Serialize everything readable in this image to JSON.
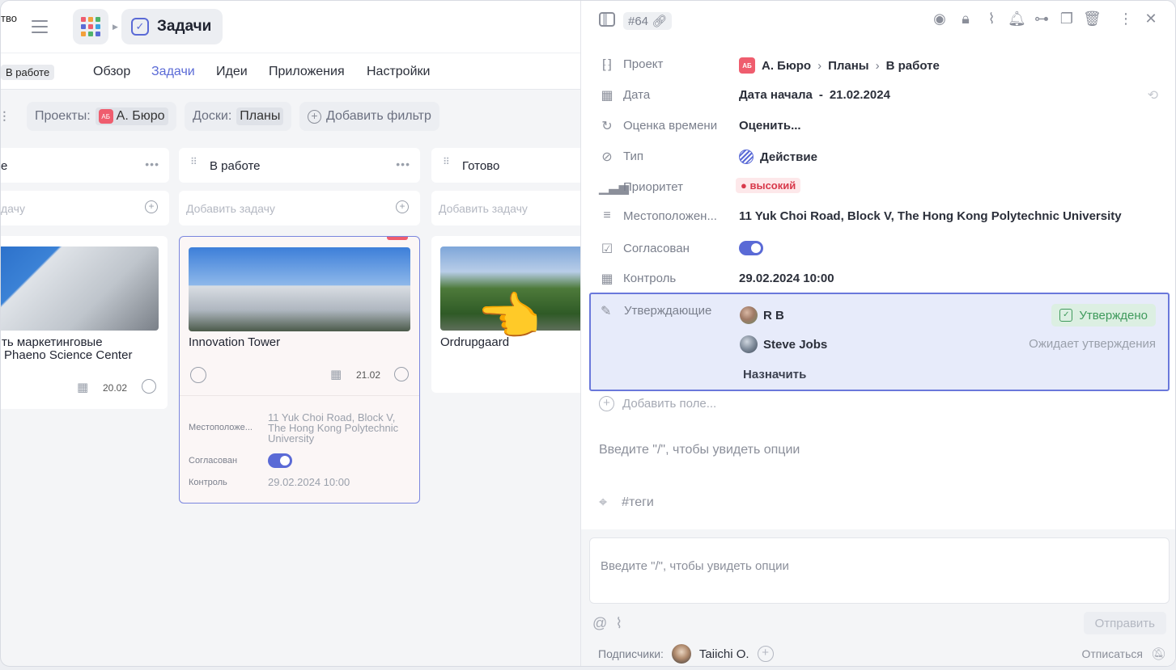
{
  "workspace": {
    "name_cut": "тво",
    "status_tag": "В работе"
  },
  "header": {
    "title": "Задачи"
  },
  "nav": {
    "items": [
      "Обзор",
      "Задачи",
      "Идеи",
      "Приложения",
      "Настройки"
    ],
    "active": "Задачи"
  },
  "filters": {
    "projects_label": "Проекты:",
    "projects_value": "А. Бюро",
    "projects_badge": "АБ",
    "boards_label": "Доски:",
    "boards_value": "Планы",
    "add_filter": "Добавить фильтр"
  },
  "columns": [
    {
      "name": "е",
      "add_placeholder": "дачу"
    },
    {
      "name": "В работе",
      "add_placeholder": "Добавить задачу"
    },
    {
      "name": "Готово",
      "add_placeholder": "Добавить задачу"
    }
  ],
  "cards": {
    "c1": {
      "title_line1": "ть маркетинговые",
      "title_line2": "Phaeno Science Center",
      "date": "20.02"
    },
    "c2": {
      "title": "Innovation Tower",
      "date": "21.02",
      "location_label": "Местоположе...",
      "location_value": "11 Yuk Choi Road, Block V, The Hong Kong Polytechnic University",
      "agreed_label": "Согласован",
      "control_label": "Контроль",
      "control_value": "29.02.2024 10:00"
    },
    "c3": {
      "title": "Ordrupgaard"
    }
  },
  "panel": {
    "task_id": "#64",
    "fields": {
      "project": {
        "label": "Проект",
        "badge": "АБ",
        "path": [
          "А. Бюро",
          "Планы",
          "В работе"
        ]
      },
      "date": {
        "label": "Дата",
        "value_start": "Дата начала",
        "separator": "-",
        "value_date": "21.02.2024"
      },
      "estimate": {
        "label": "Оценка времени",
        "value": "Оценить..."
      },
      "type": {
        "label": "Тип",
        "value": "Действие"
      },
      "priority": {
        "label": "Приоритет",
        "value": "высокий"
      },
      "location": {
        "label": "Местоположен...",
        "value": "11 Yuk Choi Road, Block V, The Hong Kong Polytechnic University"
      },
      "agreed": {
        "label": "Согласован"
      },
      "control": {
        "label": "Контроль",
        "value": "29.02.2024 10:00"
      }
    },
    "approvers": {
      "label": "Утверждающие",
      "list": [
        {
          "name": "R B",
          "status": "Утверждено"
        },
        {
          "name": "Steve Jobs",
          "status": "Ожидает утверждения"
        }
      ],
      "assign": "Назначить"
    },
    "add_field": "Добавить поле...",
    "description_placeholder": "Введите \"/\", чтобы увидеть опции",
    "tags_placeholder": "#теги",
    "comment": {
      "placeholder": "Введите \"/\", чтобы увидеть опции",
      "send": "Отправить",
      "subscribers_label": "Подписчики:",
      "subscriber": "Taiichi O.",
      "unsubscribe": "Отписаться"
    }
  },
  "colors": {
    "accent": "#5a6ad6",
    "badge": "#ef5d6e",
    "approved": "#3f9a5c",
    "priority": "#d8394b"
  }
}
